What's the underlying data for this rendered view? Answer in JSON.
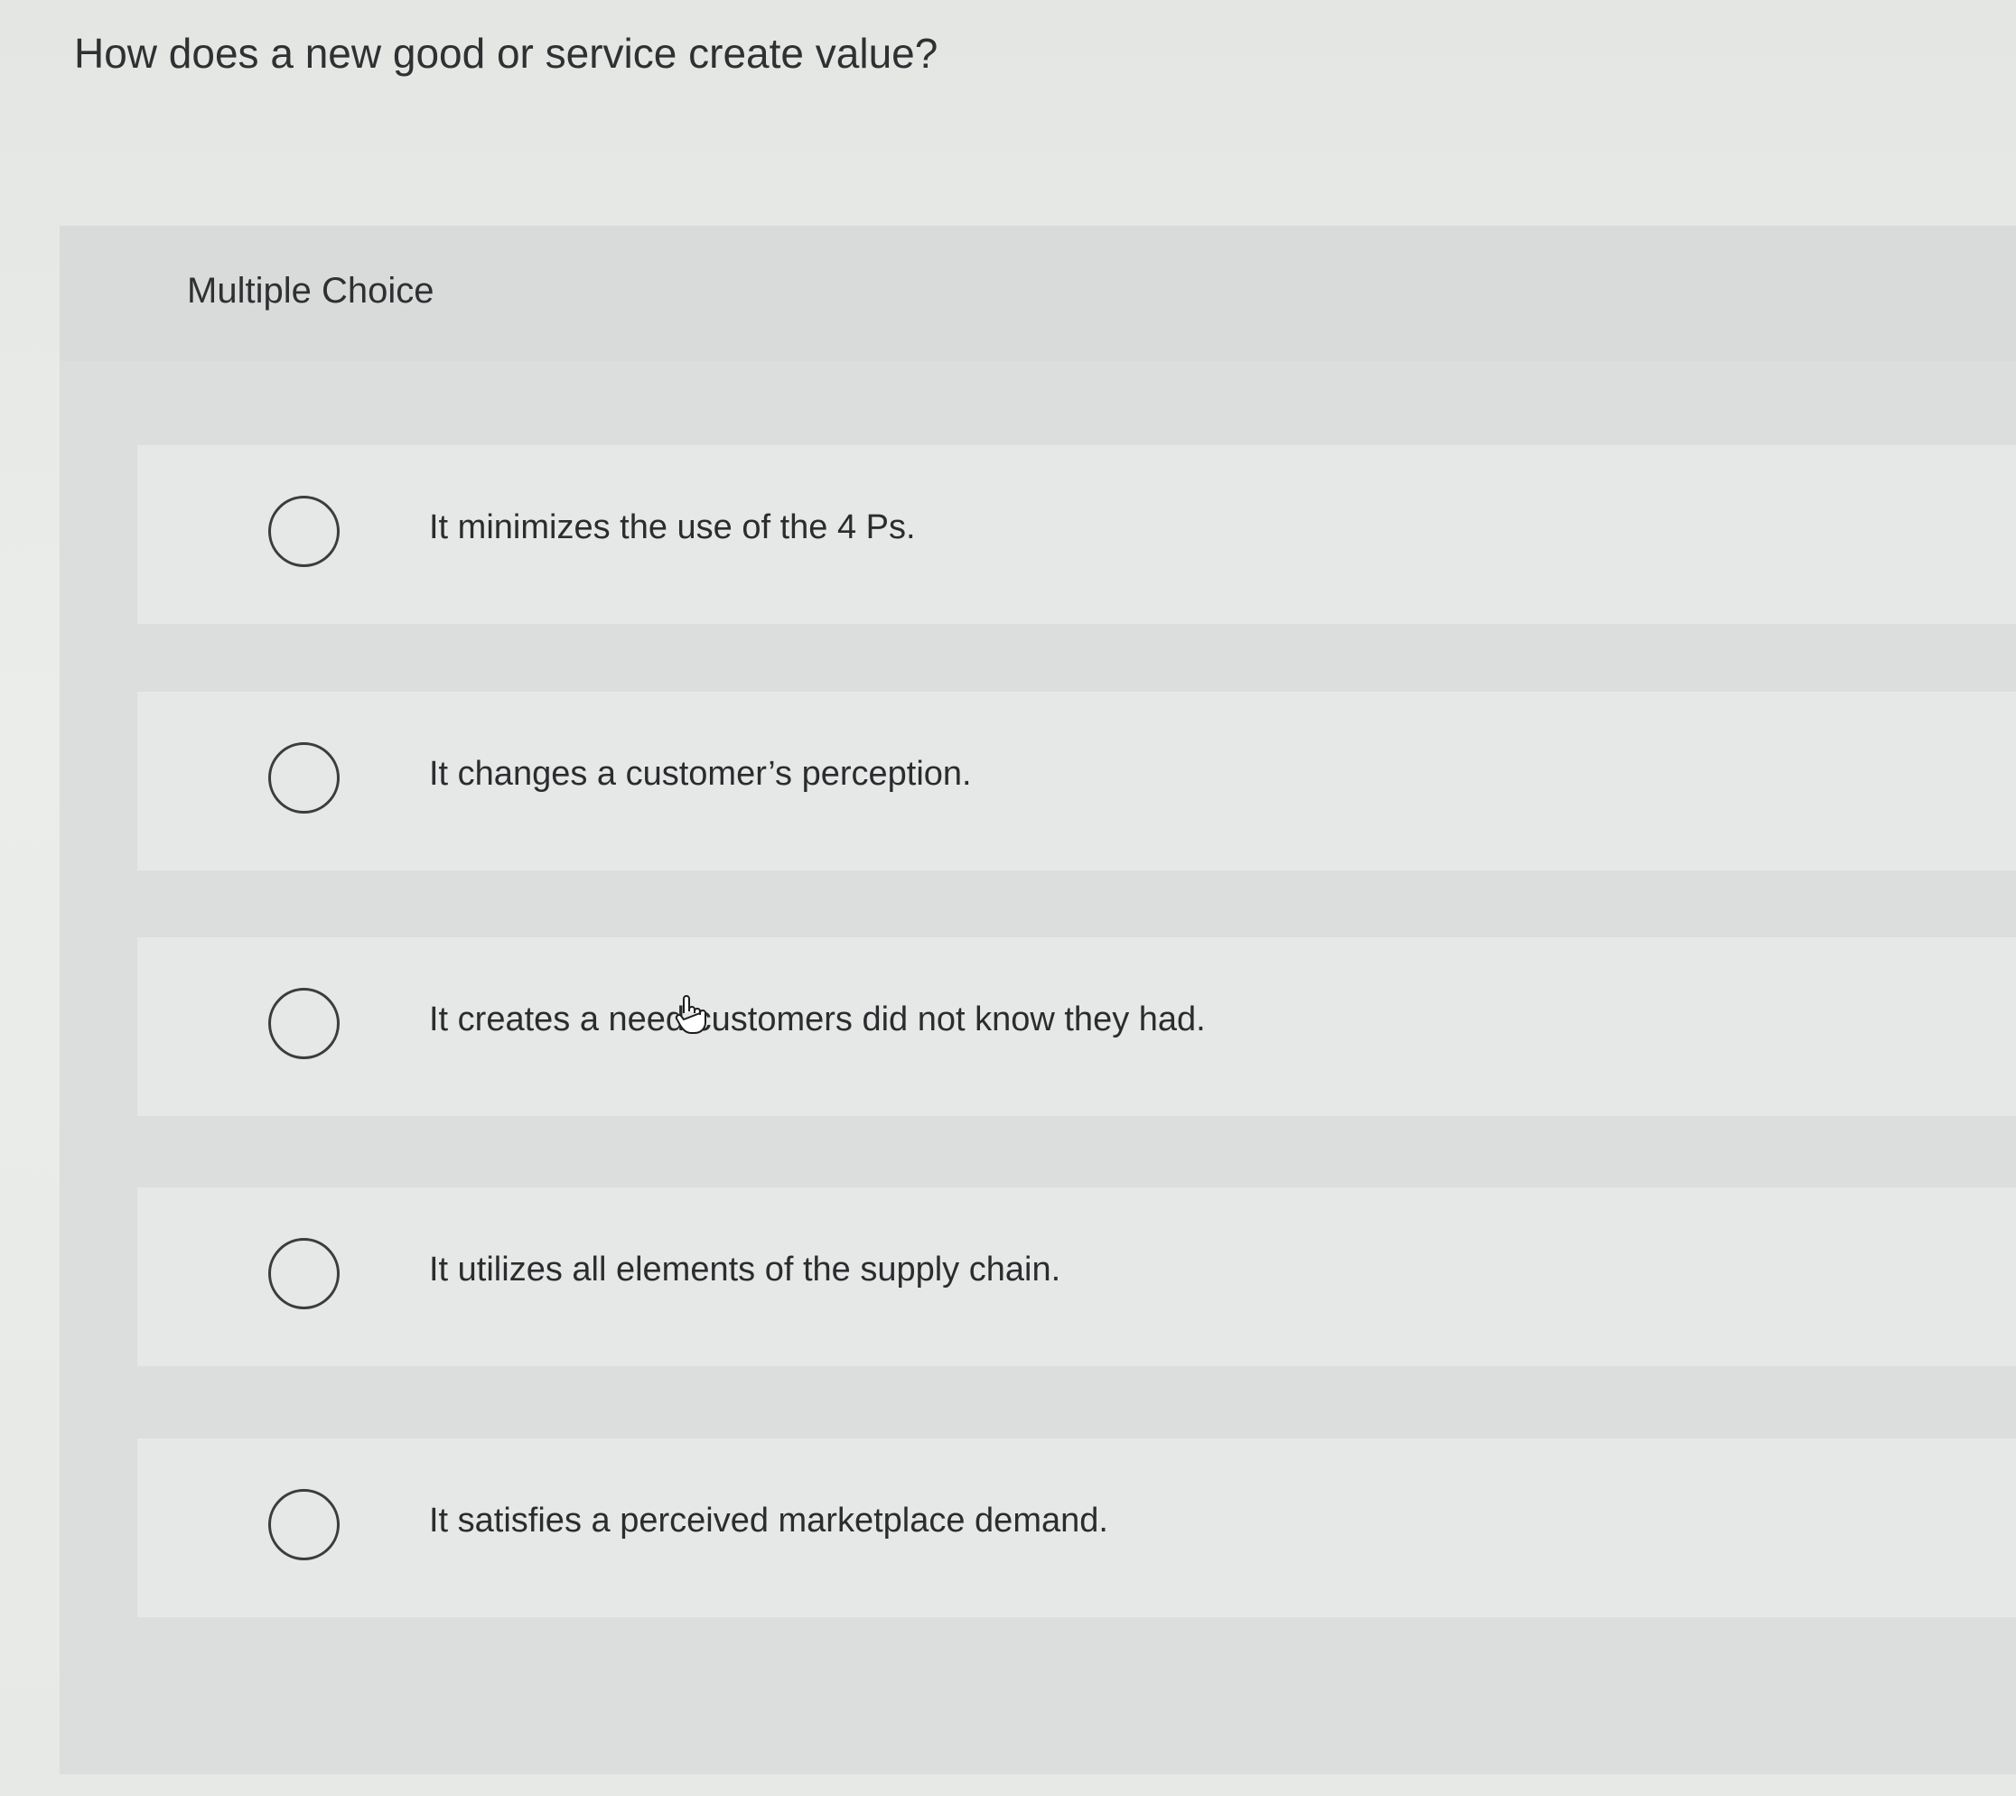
{
  "question": {
    "title": "How does a new good or service create value?"
  },
  "panel": {
    "label": "Multiple Choice"
  },
  "options": [
    {
      "label": "It minimizes the use of the 4 Ps."
    },
    {
      "label": "It changes a customer’s perception."
    },
    {
      "label": "It creates a need customers did not know they had."
    },
    {
      "label": "It utilizes all elements of the supply chain."
    },
    {
      "label": "It satisfies a perceived marketplace demand."
    }
  ],
  "icons": {
    "radio": "radio-circle-icon",
    "cursor": "hand-pointer-cursor-icon"
  }
}
